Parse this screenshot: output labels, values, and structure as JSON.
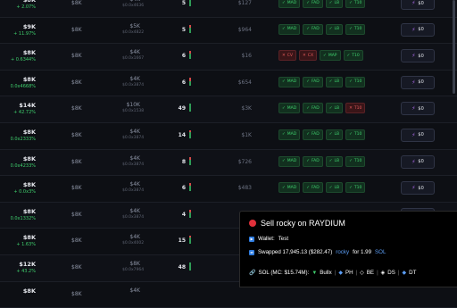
{
  "rows": [
    {
      "mc": "$8K",
      "chg": "+ 2.07%",
      "liq": "$8K",
      "vol": "$4K",
      "vol_sub": "$0.0x4636",
      "tx": "5",
      "hold": "$127",
      "tags": [
        "MAD",
        "FAD",
        "LB",
        "T10"
      ],
      "bad": [
        false,
        false,
        false,
        false
      ],
      "buy": "$0",
      "red": 0.0
    },
    {
      "mc": "$9K",
      "chg": "+ 11.97%",
      "liq": "$8K",
      "vol": "$5K",
      "vol_sub": "$0.0x4822",
      "tx": "5",
      "hold": "$964",
      "tags": [
        "MAD",
        "FAD",
        "LB",
        "T10"
      ],
      "bad": [
        false,
        false,
        false,
        false
      ],
      "buy": "$0",
      "red": 0.3
    },
    {
      "mc": "$8K",
      "chg": "+ 0.6344%",
      "liq": "$8K",
      "vol": "$4K",
      "vol_sub": "$0.0x1667",
      "tx": "6",
      "hold": "$16",
      "tags": [
        "CV",
        "CX",
        "MAP",
        "T10"
      ],
      "bad": [
        true,
        true,
        false,
        false
      ],
      "buy": "$0",
      "red": 0.3
    },
    {
      "mc": "$8K",
      "chg": "0.0x4668%",
      "liq": "$8K",
      "vol": "$4K",
      "vol_sub": "$0.0x3874",
      "tx": "6",
      "hold": "$654",
      "tags": [
        "MAD",
        "FAD",
        "LB",
        "T10"
      ],
      "bad": [
        false,
        false,
        false,
        false
      ],
      "buy": "$0",
      "red": 0.4
    },
    {
      "mc": "$14K",
      "chg": "+ 42.72%",
      "liq": "$8K",
      "vol": "$10K",
      "vol_sub": "$0.0x1538",
      "tx": "49",
      "hold": "$3K",
      "tags": [
        "MAD",
        "FAD",
        "LB",
        "T10"
      ],
      "bad": [
        false,
        false,
        false,
        true
      ],
      "buy": "$0",
      "red": 0.0
    },
    {
      "mc": "$8K",
      "chg": "0.0x2333%",
      "liq": "$8K",
      "vol": "$4K",
      "vol_sub": "$0.0x3874",
      "tx": "14",
      "hold": "$1K",
      "tags": [
        "MAD",
        "FAD",
        "LB",
        "T10"
      ],
      "bad": [
        false,
        false,
        false,
        false
      ],
      "buy": "$0",
      "red": 0.2
    },
    {
      "mc": "$8K",
      "chg": "0.0x4233%",
      "liq": "$8K",
      "vol": "$4K",
      "vol_sub": "$0.0x3874",
      "tx": "8",
      "hold": "$726",
      "tags": [
        "MAD",
        "FAD",
        "LB",
        "T10"
      ],
      "bad": [
        false,
        false,
        false,
        false
      ],
      "buy": "$0",
      "red": 0.3
    },
    {
      "mc": "$8K",
      "chg": "+ 0.0x3%",
      "liq": "$8K",
      "vol": "$4K",
      "vol_sub": "$0.0x3874",
      "tx": "6",
      "hold": "$483",
      "tags": [
        "MAD",
        "FAD",
        "LB",
        "T10"
      ],
      "bad": [
        false,
        false,
        false,
        false
      ],
      "buy": "$0",
      "red": 0.3
    },
    {
      "mc": "$8K",
      "chg": "0.0x1332%",
      "liq": "$8K",
      "vol": "$4K",
      "vol_sub": "$0.0x3874",
      "tx": "4",
      "hold": "",
      "tags": [],
      "bad": [],
      "buy": "$0",
      "red": 0.3
    },
    {
      "mc": "$8K",
      "chg": "+ 1.63%",
      "liq": "$8K",
      "vol": "$4K",
      "vol_sub": "$0.0x4002",
      "tx": "15",
      "hold": "",
      "tags": [],
      "bad": [],
      "buy": "$0",
      "red": 0.2
    },
    {
      "mc": "$12K",
      "chg": "+ 43.2%",
      "liq": "$8K",
      "vol": "$8K",
      "vol_sub": "$0.0x7964",
      "tx": "48",
      "hold": "",
      "tags": [],
      "bad": [],
      "buy": "$0",
      "red": 0.0
    },
    {
      "mc": "$8K",
      "chg": "",
      "liq": "$8K",
      "vol": "$4K",
      "vol_sub": "",
      "tx": "",
      "hold": "",
      "tags": [],
      "bad": [],
      "buy": "",
      "red": 0.0
    }
  ],
  "notification": {
    "title": "Sell rocky on RAYDIUM",
    "wallet_label": "Wallet:",
    "wallet_value": "Test",
    "swap_prefix": "Swapped 17,945.13 ($282.47)",
    "swap_token": "rocky",
    "swap_mid": "for 1.99",
    "swap_unit": "SOL",
    "sol_label": "SOL (MC: $15.74M):",
    "links": [
      "Bullx",
      "PH",
      "BE",
      "DS",
      "DT"
    ]
  },
  "colors": {
    "green": "#3fcf6d",
    "red": "#e25b5b",
    "accent": "#5b9df5",
    "purple": "#b26df0"
  }
}
